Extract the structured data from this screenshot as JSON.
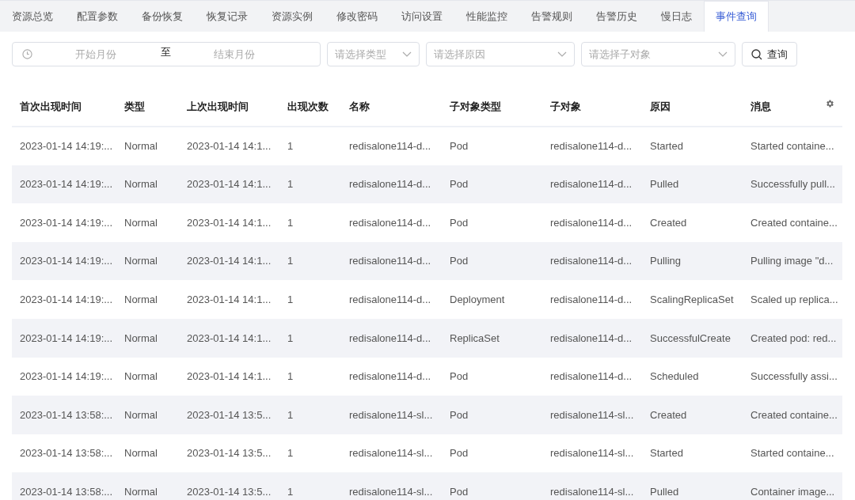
{
  "tabs": [
    {
      "label": "资源总览",
      "selected": false
    },
    {
      "label": "配置参数",
      "selected": false
    },
    {
      "label": "备份恢复",
      "selected": false
    },
    {
      "label": "恢复记录",
      "selected": false
    },
    {
      "label": "资源实例",
      "selected": false
    },
    {
      "label": "修改密码",
      "selected": false
    },
    {
      "label": "访问设置",
      "selected": false
    },
    {
      "label": "性能监控",
      "selected": false
    },
    {
      "label": "告警规则",
      "selected": false
    },
    {
      "label": "告警历史",
      "selected": false
    },
    {
      "label": "慢日志",
      "selected": false
    },
    {
      "label": "事件查询",
      "selected": true
    }
  ],
  "filters": {
    "date_range": {
      "start_placeholder": "开始月份",
      "separator": "至",
      "end_placeholder": "结束月份"
    },
    "selects": [
      {
        "placeholder": "请选择类型"
      },
      {
        "placeholder": "请选择原因"
      },
      {
        "placeholder": "请选择子对象"
      }
    ],
    "query_button": "查询"
  },
  "table": {
    "columns": [
      "首次出现时间",
      "类型",
      "上次出现时间",
      "出现次数",
      "名称",
      "子对象类型",
      "子对象",
      "原因",
      "消息"
    ],
    "rows": [
      [
        "2023-01-14 14:19:...",
        "Normal",
        "2023-01-14 14:1...",
        "1",
        "redisalone114-d...",
        "Pod",
        "redisalone114-d...",
        "Started",
        "Started containe..."
      ],
      [
        "2023-01-14 14:19:...",
        "Normal",
        "2023-01-14 14:1...",
        "1",
        "redisalone114-d...",
        "Pod",
        "redisalone114-d...",
        "Pulled",
        "Successfully pull..."
      ],
      [
        "2023-01-14 14:19:...",
        "Normal",
        "2023-01-14 14:1...",
        "1",
        "redisalone114-d...",
        "Pod",
        "redisalone114-d...",
        "Created",
        "Created containe..."
      ],
      [
        "2023-01-14 14:19:...",
        "Normal",
        "2023-01-14 14:1...",
        "1",
        "redisalone114-d...",
        "Pod",
        "redisalone114-d...",
        "Pulling",
        "Pulling image \"d..."
      ],
      [
        "2023-01-14 14:19:...",
        "Normal",
        "2023-01-14 14:1...",
        "1",
        "redisalone114-d...",
        "Deployment",
        "redisalone114-d...",
        "ScalingReplicaSet",
        "Scaled up replica..."
      ],
      [
        "2023-01-14 14:19:...",
        "Normal",
        "2023-01-14 14:1...",
        "1",
        "redisalone114-d...",
        "ReplicaSet",
        "redisalone114-d...",
        "SuccessfulCreate",
        "Created pod: red..."
      ],
      [
        "2023-01-14 14:19:...",
        "Normal",
        "2023-01-14 14:1...",
        "1",
        "redisalone114-d...",
        "Pod",
        "redisalone114-d...",
        "Scheduled",
        "Successfully assi..."
      ],
      [
        "2023-01-14 13:58:...",
        "Normal",
        "2023-01-14 13:5...",
        "1",
        "redisalone114-sl...",
        "Pod",
        "redisalone114-sl...",
        "Created",
        "Created containe..."
      ],
      [
        "2023-01-14 13:58:...",
        "Normal",
        "2023-01-14 13:5...",
        "1",
        "redisalone114-sl...",
        "Pod",
        "redisalone114-sl...",
        "Started",
        "Started containe..."
      ],
      [
        "2023-01-14 13:58:...",
        "Normal",
        "2023-01-14 13:5...",
        "1",
        "redisalone114-sl...",
        "Pod",
        "redisalone114-sl...",
        "Pulled",
        "Container image..."
      ]
    ]
  }
}
